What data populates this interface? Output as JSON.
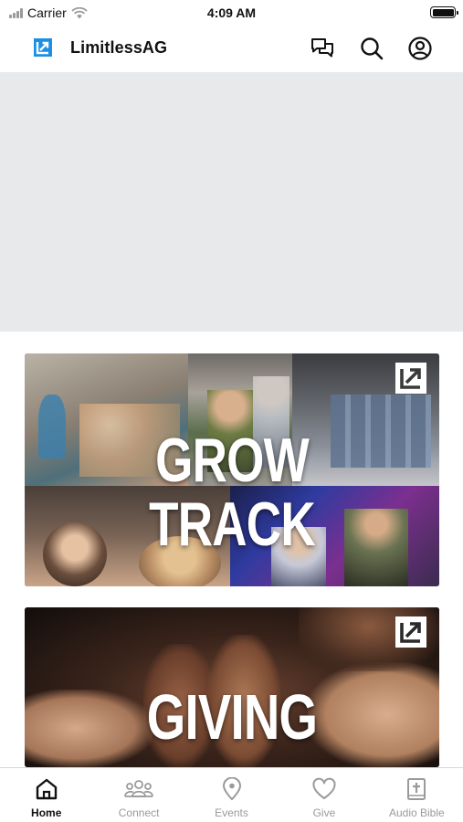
{
  "status_bar": {
    "carrier": "Carrier",
    "time": "4:09 AM"
  },
  "header": {
    "app_name": "LimitlessAG",
    "icons": [
      "chat-icon",
      "search-icon",
      "account-icon"
    ],
    "brand_color": "#1a8fe3"
  },
  "cards": [
    {
      "title": "GROW TRACK",
      "badge_icon": "limitless-logo-icon"
    },
    {
      "title": "GIVING",
      "badge_icon": "limitless-logo-icon"
    }
  ],
  "tab_bar": {
    "active": "Home",
    "tabs": [
      {
        "label": "Home",
        "icon": "home-icon"
      },
      {
        "label": "Connect",
        "icon": "group-icon"
      },
      {
        "label": "Events",
        "icon": "location-pin-icon"
      },
      {
        "label": "Give",
        "icon": "heart-icon"
      },
      {
        "label": "Audio Bible",
        "icon": "bible-icon"
      }
    ]
  }
}
